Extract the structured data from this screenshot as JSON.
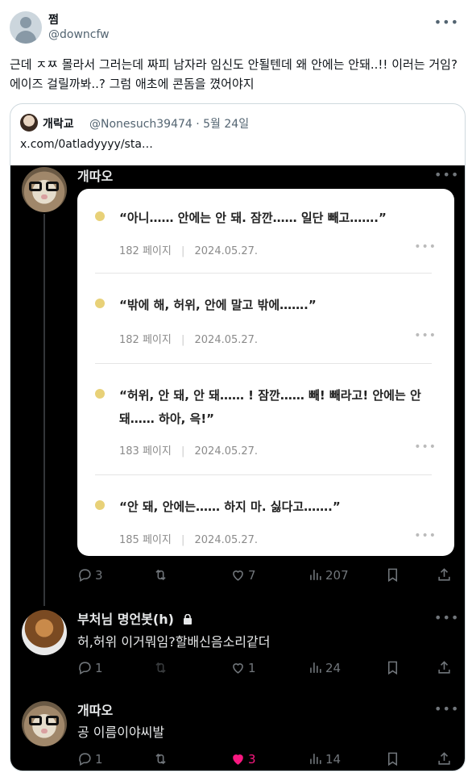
{
  "tweet": {
    "author_name": "쩜",
    "author_handle": "@downcfw",
    "text": "근데 ㅈㅉ 몰라서 그러는데 짜피 남자라 임신도 안될텐데 왜 안에는 안돼..!! 이러는 거임? 에이즈 걸릴까봐..? 그럼 애초에 콘돔을 꼈어야지"
  },
  "quote": {
    "author_name": "개락교",
    "meta": "@Nonesuch39474 · 5월 24일",
    "link_text": "x.com/0atladyyyy/sta…"
  },
  "thread": {
    "post1": {
      "author": "개따오",
      "card_items": [
        {
          "text": "“아니…… 안에는 안 돼. 잠깐…… 일단 빼고…….”",
          "page": "182 페이지",
          "date": "2024.05.27."
        },
        {
          "text": "“밖에 해, 허위, 안에 말고 밖에…….”",
          "page": "182 페이지",
          "date": "2024.05.27."
        },
        {
          "text": "“허위, 안 돼, 안 돼…… ! 잠깐…… 빼! 빼라고! 안에는 안 돼…… 하아, 윽!”",
          "page": "183 페이지",
          "date": "2024.05.27."
        },
        {
          "text": "“안 돼, 안에는…… 하지 마. 싫다고…….”",
          "page": "185 페이지",
          "date": "2024.05.27."
        }
      ],
      "stats": {
        "replies": "3",
        "likes": "7",
        "views": "207"
      }
    },
    "post2": {
      "author": "부처님 명언봇(h)",
      "text": "허,허위 이거뭐임?할배신음소리같더",
      "stats": {
        "replies": "1",
        "likes": "1",
        "views": "24"
      }
    },
    "post3": {
      "author": "개따오",
      "text": "공 이름이야씨발",
      "stats": {
        "replies": "1",
        "likes": "3",
        "views": "14"
      }
    }
  },
  "colors": {
    "like_pink": "#f91880",
    "bullet_yellow": "#e8d178",
    "dark_bg": "#000000"
  },
  "icons": [
    "reply-icon",
    "retweet-icon",
    "like-icon",
    "views-icon",
    "bookmark-icon",
    "share-icon",
    "lock-icon",
    "more-icon"
  ]
}
